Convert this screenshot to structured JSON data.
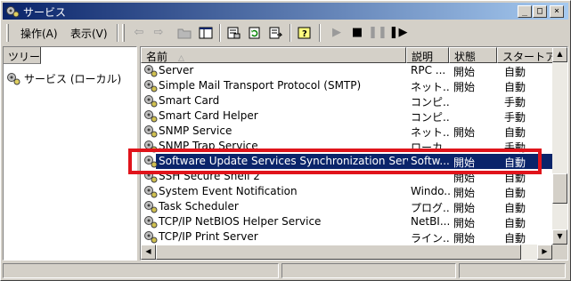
{
  "window": {
    "title": "サービス",
    "controls": {
      "minimize": "_",
      "maximize": "□",
      "close": "×"
    }
  },
  "menu": {
    "action": "操作(A)",
    "view": "表示(V)"
  },
  "toolbar": {
    "icons": [
      "back-arrow-icon",
      "forward-arrow-icon",
      "up-folder-icon",
      "show-tree-icon",
      "properties-icon",
      "refresh-icon",
      "export-list-icon",
      "help-icon",
      "play-icon",
      "stop-icon",
      "pause-icon",
      "restart-icon"
    ]
  },
  "tree": {
    "tab_label": "ツリー",
    "root_label": "サービス (ローカル)"
  },
  "list": {
    "columns": [
      "名前",
      "説明",
      "状態",
      "スタートアップ"
    ],
    "sort_indicator": "△",
    "rows": [
      {
        "name": "Server",
        "desc": "RPC ...",
        "status": "開始",
        "startup": "自動"
      },
      {
        "name": "Simple Mail Transport Protocol (SMTP)",
        "desc": "ネット...",
        "status": "開始",
        "startup": "自動"
      },
      {
        "name": "Smart Card",
        "desc": "コンピ...",
        "status": "",
        "startup": "手動"
      },
      {
        "name": "Smart Card Helper",
        "desc": "コンピ...",
        "status": "",
        "startup": "手動"
      },
      {
        "name": "SNMP Service",
        "desc": "ネット...",
        "status": "開始",
        "startup": "自動"
      },
      {
        "name": "SNMP Trap Service",
        "desc": "ローカ...",
        "status": "",
        "startup": "手動"
      },
      {
        "name": "Software Update Services Synchronization Service",
        "desc": "Softw...",
        "status": "開始",
        "startup": "自動"
      },
      {
        "name": "SSH Secure Shell 2",
        "desc": "",
        "status": "開始",
        "startup": "自動"
      },
      {
        "name": "System Event Notification",
        "desc": "Windo...",
        "status": "開始",
        "startup": "自動"
      },
      {
        "name": "Task Scheduler",
        "desc": "プログ...",
        "status": "開始",
        "startup": "自動"
      },
      {
        "name": "TCP/IP NetBIOS Helper Service",
        "desc": "NetBI...",
        "status": "開始",
        "startup": "自動"
      },
      {
        "name": "TCP/IP Print Server",
        "desc": "ライン...",
        "status": "開始",
        "startup": "自動"
      }
    ],
    "selected_index": 6
  },
  "colors": {
    "highlight": "#0a246a",
    "annotation_box": "#e0141b",
    "chrome": "#d4d0c8"
  }
}
